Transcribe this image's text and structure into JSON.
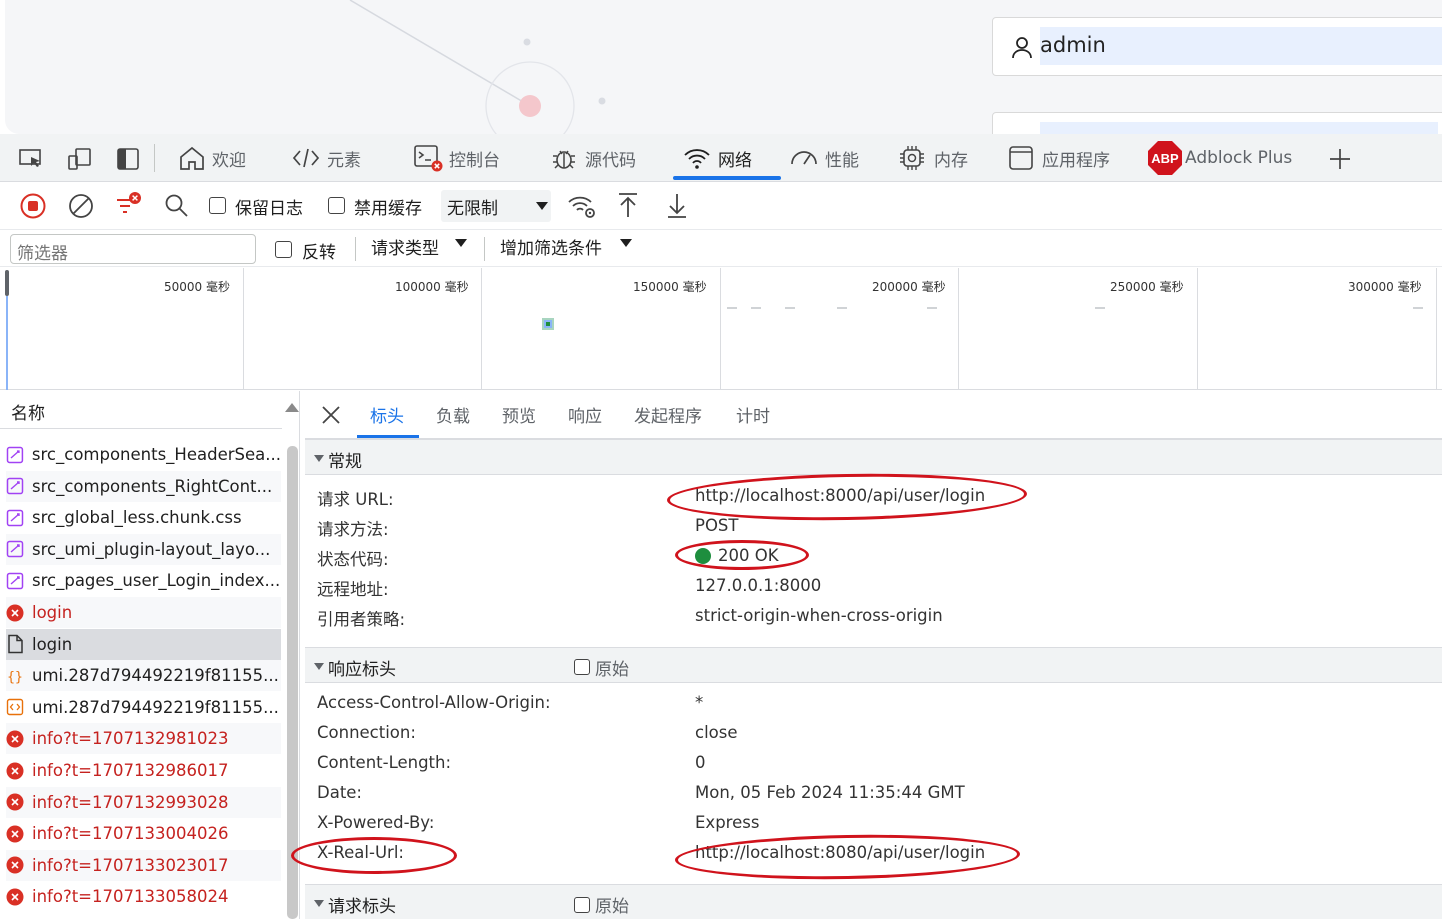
{
  "page": {
    "username": "admin"
  },
  "tabs": [
    {
      "label": "欢迎"
    },
    {
      "label": "元素"
    },
    {
      "label": "控制台"
    },
    {
      "label": "源代码"
    },
    {
      "label": "网络"
    },
    {
      "label": "性能"
    },
    {
      "label": "内存"
    },
    {
      "label": "应用程序"
    },
    {
      "label": "Adblock Plus"
    }
  ],
  "toolbar": {
    "preserve_log": "保留日志",
    "disable_cache": "禁用缓存",
    "throttle": "无限制"
  },
  "filter": {
    "placeholder": "筛选器",
    "invert": "反转",
    "request_type": "请求类型",
    "more_filters": "增加筛选条件"
  },
  "overview": {
    "ticks": [
      "50000 毫秒",
      "100000 毫秒",
      "150000 毫秒",
      "200000 毫秒",
      "250000 毫秒",
      "300000 毫秒"
    ]
  },
  "list": {
    "header": "名称",
    "items": [
      {
        "name": "src_components_HeaderSea..."
      },
      {
        "name": "src_components_RightCont..."
      },
      {
        "name": "src_global_less.chunk.css"
      },
      {
        "name": "src_umi_plugin-layout_layo..."
      },
      {
        "name": "src_pages_user_Login_index..."
      },
      {
        "name": "login"
      },
      {
        "name": "login"
      },
      {
        "name": "umi.287d794492219f81155..."
      },
      {
        "name": "umi.287d794492219f81155..."
      },
      {
        "name": "info?t=1707132981023"
      },
      {
        "name": "info?t=1707132986017"
      },
      {
        "name": "info?t=1707132993028"
      },
      {
        "name": "info?t=1707133004026"
      },
      {
        "name": "info?t=1707133023017"
      },
      {
        "name": "info?t=1707133058024"
      }
    ]
  },
  "detail": {
    "tabs": [
      "标头",
      "负载",
      "预览",
      "响应",
      "发起程序",
      "计时"
    ],
    "general": {
      "title": "常规",
      "rows": [
        {
          "k": "请求 URL:",
          "v": "http://localhost:8000/api/user/login"
        },
        {
          "k": "请求方法:",
          "v": "POST"
        },
        {
          "k": "状态代码:",
          "v": "200 OK"
        },
        {
          "k": "远程地址:",
          "v": "127.0.0.1:8000"
        },
        {
          "k": "引用者策略:",
          "v": "strict-origin-when-cross-origin"
        }
      ]
    },
    "response": {
      "title": "响应标头",
      "raw": "原始",
      "rows": [
        {
          "k": "Access-Control-Allow-Origin:",
          "v": "*"
        },
        {
          "k": "Connection:",
          "v": "close"
        },
        {
          "k": "Content-Length:",
          "v": "0"
        },
        {
          "k": "Date:",
          "v": "Mon, 05 Feb 2024 11:35:44 GMT"
        },
        {
          "k": "X-Powered-By:",
          "v": "Express"
        },
        {
          "k": "X-Real-Url:",
          "v": "http://localhost:8080/api/user/login"
        }
      ]
    },
    "request": {
      "title": "请求标头",
      "raw": "原始"
    }
  },
  "colors": {
    "accent": "#1a73e8",
    "error": "#c5221f",
    "annotation": "#d0131c",
    "status_ok": "#1e8e3e"
  }
}
